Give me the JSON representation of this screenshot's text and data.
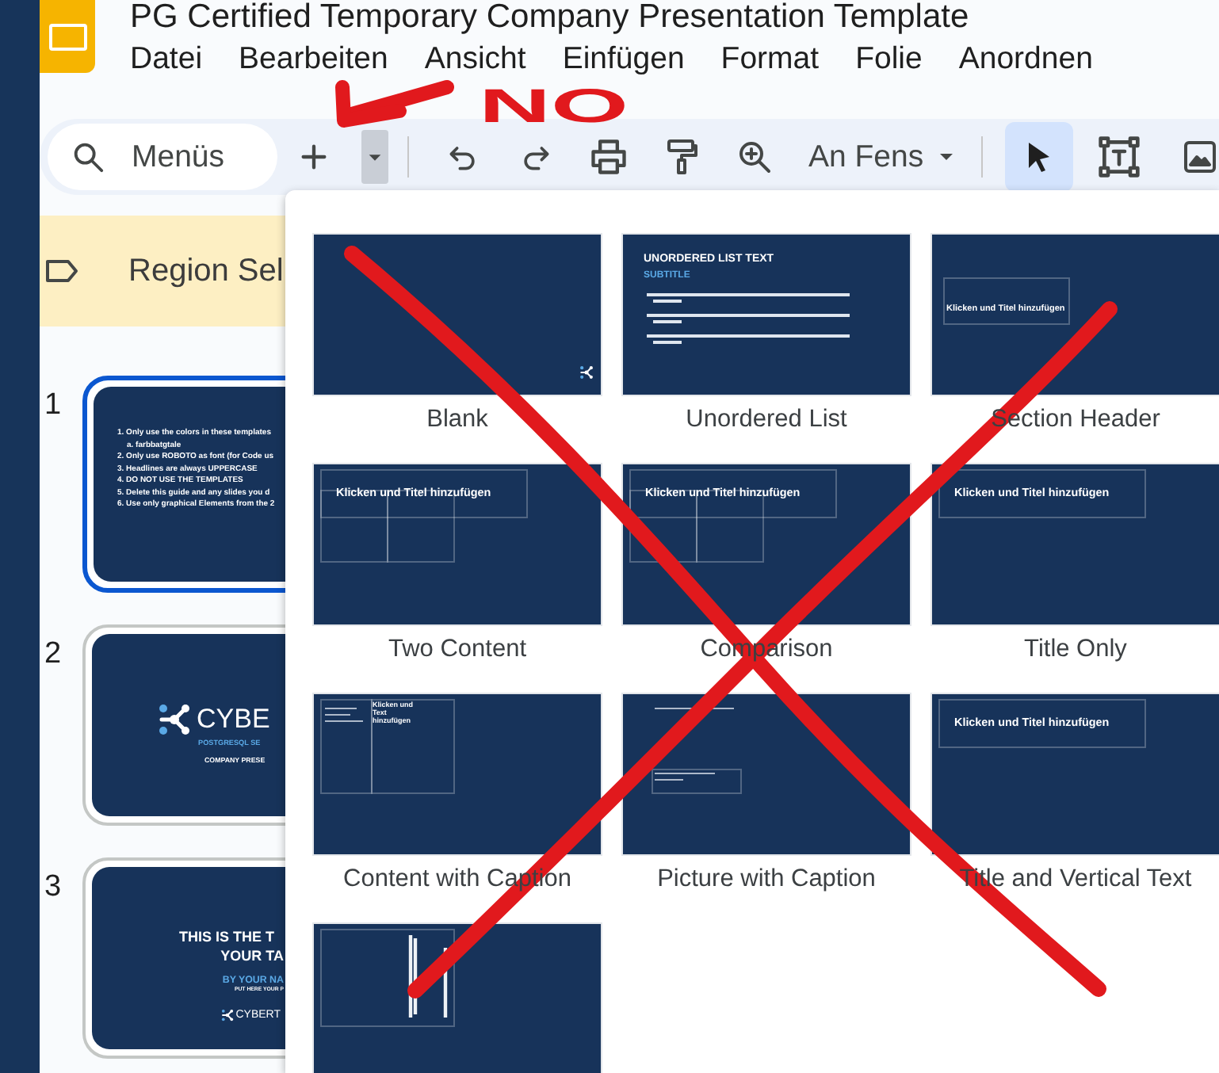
{
  "window": {
    "title": "PG Certified Temporary Company Presentation Template"
  },
  "menu": [
    "Datei",
    "Bearbeiten",
    "Ansicht",
    "Einfügen",
    "Format",
    "Folie",
    "Anordnen"
  ],
  "toolbar": {
    "search": {
      "placeholder": "Menüs"
    },
    "items": [
      {
        "kind": "add"
      },
      {
        "kind": "caret",
        "expanded": true
      },
      {
        "kind": "separator"
      },
      {
        "kind": "undo"
      },
      {
        "kind": "redo"
      },
      {
        "kind": "print"
      },
      {
        "kind": "paint"
      },
      {
        "kind": "zoom"
      },
      {
        "kind": "zoom_select",
        "value": "An Fens"
      },
      {
        "kind": "separator"
      },
      {
        "kind": "select",
        "selected": true
      },
      {
        "kind": "textbox",
        "selected": false
      },
      {
        "kind": "image",
        "selected": false
      }
    ]
  },
  "banner": {
    "text": "Region Sel"
  },
  "slides": [
    {
      "number": "1",
      "selected": true,
      "kind": "guide",
      "lines": [
        "1. Only use the colors in these templates",
        "a. farbbatgtale",
        "2. Only use ROBOTO as font (for Code us",
        "3. Headlines are always UPPERCASE",
        "4. DO NOT USE THE TEMPLATES",
        "5. Delete this guide and any slides you d",
        "6. Use only graphical Elements from the 2"
      ]
    },
    {
      "number": "2",
      "selected": false,
      "kind": "cover",
      "logo": "CYBE",
      "tagline": "POSTGRESQL SE",
      "subtitle": "COMPANY PRESE"
    },
    {
      "number": "3",
      "selected": false,
      "kind": "title",
      "lines": [
        "THIS IS THE T",
        "YOUR TA"
      ],
      "author": "BY YOUR NA",
      "note": "PUT HERE YOUR P",
      "logo": "CYBERT"
    }
  ],
  "layouts": [
    {
      "label": [
        "Blank"
      ],
      "kind": "blank"
    },
    {
      "label": [
        "Unordered List"
      ],
      "kind": "list",
      "title": "UNORDERED LIST TEXT",
      "subtitle": "SUBTITLE"
    },
    {
      "label": [
        "Section Header"
      ],
      "kind": "section",
      "title": "Klicken und Titel hinzufügen"
    },
    {
      "label": [
        "Two Content"
      ],
      "kind": "two",
      "title": "Klicken und Titel hinzufügen"
    },
    {
      "label": [
        "Comparison"
      ],
      "kind": "two",
      "title": "Klicken und Titel hinzufügen"
    },
    {
      "label": [
        "Title Only"
      ],
      "kind": "title_only",
      "title": "Klicken und Titel hinzufügen"
    },
    {
      "label": [
        "Content with Caption"
      ],
      "kind": "caption",
      "title": "Klicken und Text hinzufügen"
    },
    {
      "label": [
        "Picture with Caption"
      ],
      "kind": "picture_caption"
    },
    {
      "label": [
        "Title and Vertical Text"
      ],
      "kind": "title_only",
      "title": "Klicken und Titel hinzufügen"
    },
    {
      "kind": "vertical"
    }
  ],
  "annotations": [
    {
      "kind": "arrow"
    },
    {
      "kind": "text",
      "text": "NO"
    },
    {
      "kind": "cross"
    }
  ]
}
